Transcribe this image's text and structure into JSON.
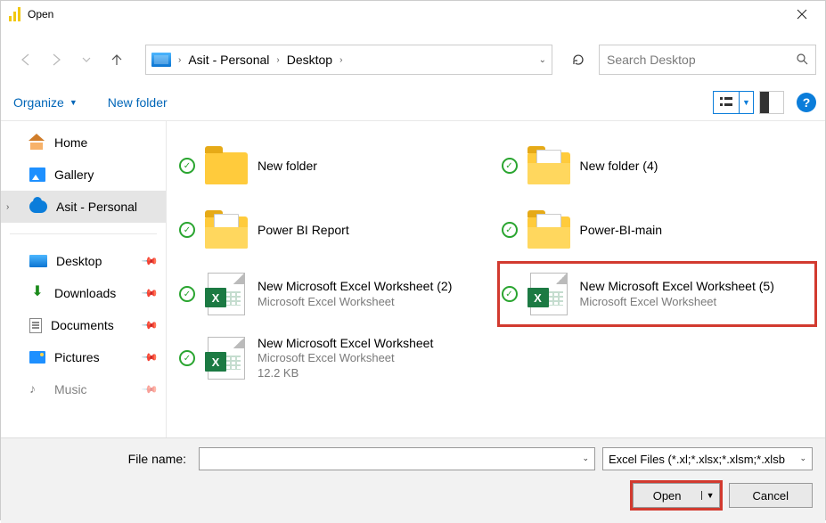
{
  "window": {
    "title": "Open"
  },
  "breadcrumb": {
    "a": "Asit - Personal",
    "b": "Desktop"
  },
  "search": {
    "placeholder": "Search Desktop"
  },
  "toolbar": {
    "organize": "Organize",
    "newfolder": "New folder"
  },
  "sidebar": {
    "home": "Home",
    "gallery": "Gallery",
    "asit": "Asit - Personal",
    "desktop": "Desktop",
    "downloads": "Downloads",
    "documents": "Documents",
    "pictures": "Pictures",
    "music": "Music"
  },
  "files": {
    "f0": {
      "name": "New folder"
    },
    "f1": {
      "name": "New folder (4)"
    },
    "f2": {
      "name": "Power BI Report"
    },
    "f3": {
      "name": "Power-BI-main"
    },
    "f4": {
      "name": "New Microsoft Excel Worksheet (2)",
      "type": "Microsoft Excel Worksheet"
    },
    "f5": {
      "name": "New Microsoft Excel Worksheet (5)",
      "type": "Microsoft Excel Worksheet"
    },
    "f6": {
      "name": "New Microsoft Excel Worksheet",
      "type": "Microsoft Excel Worksheet",
      "size": "12.2 KB"
    }
  },
  "footer": {
    "label": "File name:",
    "filetype": "Excel Files (*.xl;*.xlsx;*.xlsm;*.xlsb",
    "open": "Open",
    "cancel": "Cancel"
  }
}
